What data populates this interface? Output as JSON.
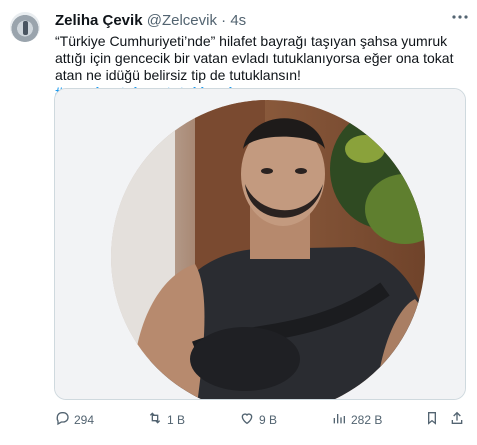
{
  "tweet": {
    "display_name": "Zeliha Çevik",
    "handle": "@Zelcevik",
    "separator": "·",
    "time": "4s",
    "text": "“Türkiye Cumhuriyeti’nde” hilafet bayrağı taşıyan şahsa yumruk attığı için gencecik bir vatan evladı tutuklanıyorsa eğer ona tokat atan ne idüğü belirsiz tip de tutuklansın! ",
    "hashtag": "#oguzhantoksuntutuklansin"
  },
  "actions": {
    "replies": "294",
    "retweets": "1 B",
    "likes": "9 B",
    "views": "282 B"
  },
  "icons": [
    "more-icon",
    "reply-icon",
    "retweet-icon",
    "like-icon",
    "views-icon",
    "bookmark-icon",
    "share-icon"
  ],
  "colors": {
    "accent": "#1d9bf0",
    "secondary_text": "#536471",
    "border": "#cfd9de"
  }
}
